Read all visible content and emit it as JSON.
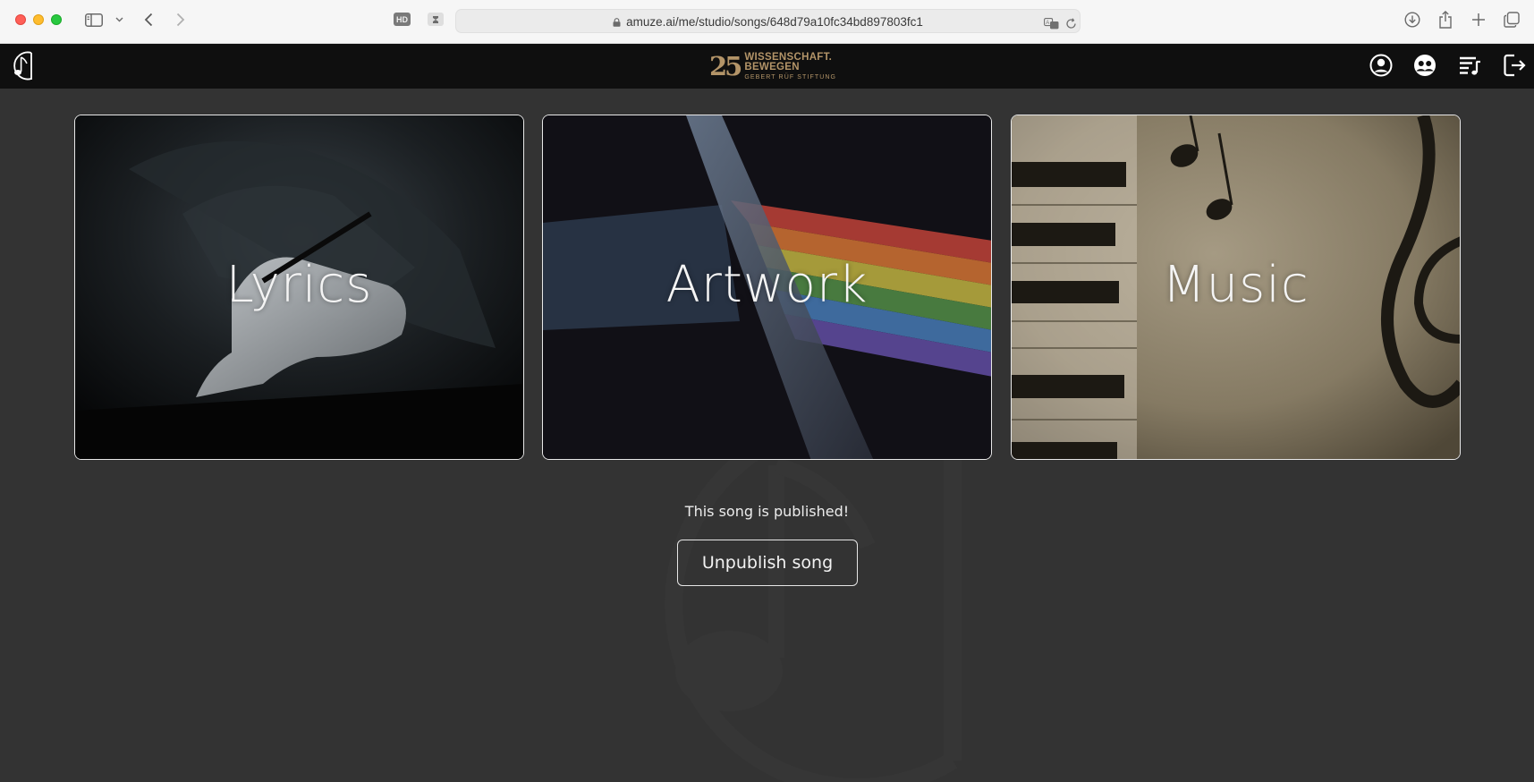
{
  "browser": {
    "url": "amuze.ai/me/studio/songs/648d79a10fc34bd897803fc1",
    "hd_badge": "HD"
  },
  "header": {
    "sponsor": {
      "number": "25",
      "line1": "WISSENSCHAFT.",
      "line2": "BEWEGEN",
      "line3": "GEBERT RÜF STIFTUNG"
    },
    "nav_icons": [
      "profile-icon",
      "community-icon",
      "playlist-icon",
      "logout-icon"
    ]
  },
  "cards": [
    {
      "label": "Lyrics"
    },
    {
      "label": "Artwork"
    },
    {
      "label": "Music"
    }
  ],
  "status_text": "This song is published!",
  "unpublish_label": "Unpublish song",
  "colors": {
    "background": "#333333",
    "appbar": "#0f0f0f",
    "sponsor_gold": "#b39468"
  }
}
